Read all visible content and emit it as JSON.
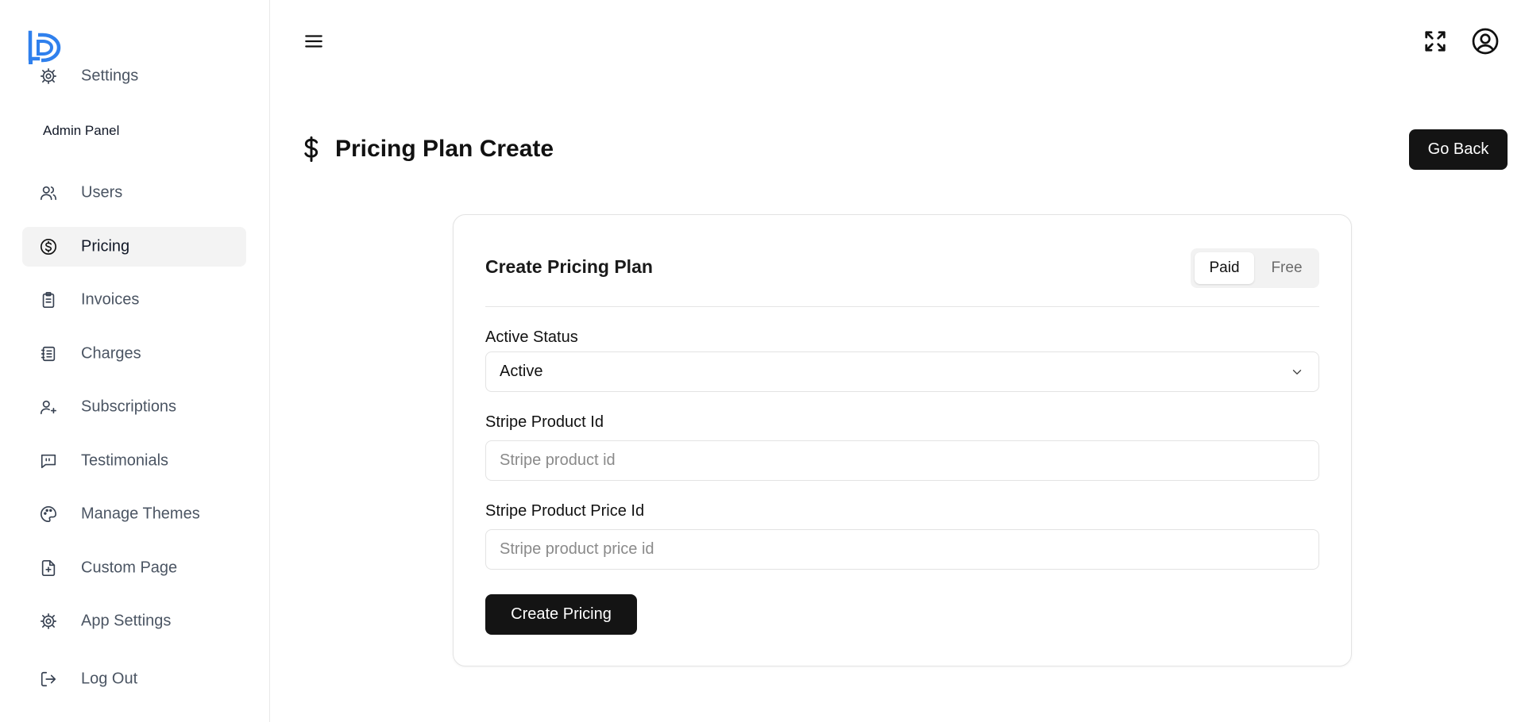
{
  "sidebar": {
    "top_item": {
      "label": "Settings",
      "icon": "gear-icon"
    },
    "section_label": "Admin Panel",
    "items": [
      {
        "label": "Users",
        "icon": "users-icon"
      },
      {
        "label": "Pricing",
        "icon": "dollar-circle-icon",
        "active": true
      },
      {
        "label": "Invoices",
        "icon": "clipboard-icon"
      },
      {
        "label": "Charges",
        "icon": "receipt-icon"
      },
      {
        "label": "Subscriptions",
        "icon": "user-plus-icon"
      },
      {
        "label": "Testimonials",
        "icon": "message-quote-icon"
      },
      {
        "label": "Manage Themes",
        "icon": "palette-icon"
      },
      {
        "label": "Custom Page",
        "icon": "file-plus-icon"
      },
      {
        "label": "App Settings",
        "icon": "gear-icon"
      }
    ],
    "logout": {
      "label": "Log Out",
      "icon": "logout-icon"
    }
  },
  "header": {
    "page_title": "Pricing Plan Create",
    "go_back_label": "Go Back"
  },
  "card": {
    "title": "Create Pricing Plan",
    "toggle": {
      "selected": "Paid",
      "options": [
        "Paid",
        "Free"
      ]
    },
    "active_status": {
      "label": "Active Status",
      "value": "Active"
    },
    "stripe_product_id": {
      "label": "Stripe Product Id",
      "placeholder": "Stripe product id",
      "value": ""
    },
    "stripe_product_price_id": {
      "label": "Stripe Product Price Id",
      "placeholder": "Stripe product price id",
      "value": ""
    },
    "submit_label": "Create Pricing"
  },
  "colors": {
    "logo_blue": "#2f80ed",
    "button_dark": "#141414",
    "active_bg": "#f3f3f3"
  }
}
